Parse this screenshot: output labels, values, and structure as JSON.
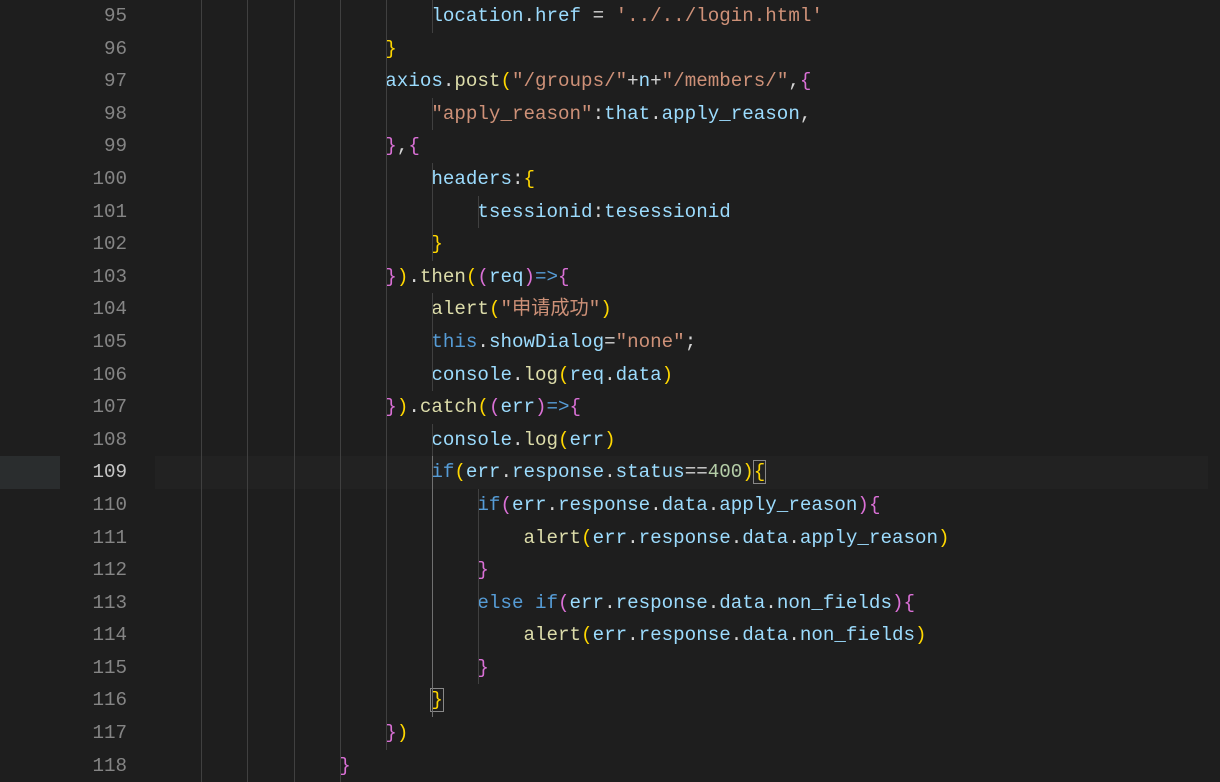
{
  "editor": {
    "activeLine": 109,
    "lines": [
      {
        "num": 95,
        "indent": 24,
        "tokens": [
          [
            "var",
            "location"
          ],
          [
            "punc",
            "."
          ],
          [
            "prop",
            "href"
          ],
          [
            "op",
            " = "
          ],
          [
            "str",
            "'../../login.html'"
          ]
        ]
      },
      {
        "num": 96,
        "indent": 20,
        "tokens": [
          [
            "ybrace",
            "}"
          ]
        ]
      },
      {
        "num": 97,
        "indent": 20,
        "tokens": [
          [
            "var",
            "axios"
          ],
          [
            "punc",
            "."
          ],
          [
            "func",
            "post"
          ],
          [
            "ybrace",
            "("
          ],
          [
            "str",
            "\"/groups/\""
          ],
          [
            "op",
            "+"
          ],
          [
            "var",
            "n"
          ],
          [
            "op",
            "+"
          ],
          [
            "str",
            "\"/members/\""
          ],
          [
            "punc",
            ","
          ],
          [
            "pbrace",
            "{"
          ]
        ]
      },
      {
        "num": 98,
        "indent": 24,
        "tokens": [
          [
            "str",
            "\"apply_reason\""
          ],
          [
            "punc",
            ":"
          ],
          [
            "var",
            "that"
          ],
          [
            "punc",
            "."
          ],
          [
            "prop",
            "apply_reason"
          ],
          [
            "punc",
            ","
          ]
        ]
      },
      {
        "num": 99,
        "indent": 20,
        "tokens": [
          [
            "pbrace",
            "}"
          ],
          [
            "punc",
            ","
          ],
          [
            "pbrace",
            "{"
          ]
        ]
      },
      {
        "num": 100,
        "indent": 24,
        "tokens": [
          [
            "prop",
            "headers"
          ],
          [
            "punc",
            ":"
          ],
          [
            "ybrace",
            "{"
          ]
        ]
      },
      {
        "num": 101,
        "indent": 28,
        "tokens": [
          [
            "prop",
            "tsessionid"
          ],
          [
            "punc",
            ":"
          ],
          [
            "var",
            "tesessionid"
          ]
        ]
      },
      {
        "num": 102,
        "indent": 24,
        "tokens": [
          [
            "ybrace",
            "}"
          ]
        ]
      },
      {
        "num": 103,
        "indent": 20,
        "tokens": [
          [
            "pbrace",
            "}"
          ],
          [
            "ybrace",
            ")"
          ],
          [
            "punc",
            "."
          ],
          [
            "func",
            "then"
          ],
          [
            "ybrace",
            "("
          ],
          [
            "pbrace",
            "("
          ],
          [
            "param",
            "req"
          ],
          [
            "pbrace",
            ")"
          ],
          [
            "kw",
            "=>"
          ],
          [
            "pbrace",
            "{"
          ]
        ]
      },
      {
        "num": 104,
        "indent": 24,
        "tokens": [
          [
            "func",
            "alert"
          ],
          [
            "ybrace",
            "("
          ],
          [
            "str",
            "\"申请成功\""
          ],
          [
            "ybrace",
            ")"
          ]
        ]
      },
      {
        "num": 105,
        "indent": 24,
        "tokens": [
          [
            "this",
            "this"
          ],
          [
            "punc",
            "."
          ],
          [
            "prop",
            "showDialog"
          ],
          [
            "op",
            "="
          ],
          [
            "str",
            "\"none\""
          ],
          [
            "punc",
            ";"
          ]
        ]
      },
      {
        "num": 106,
        "indent": 24,
        "tokens": [
          [
            "var",
            "console"
          ],
          [
            "punc",
            "."
          ],
          [
            "func",
            "log"
          ],
          [
            "ybrace",
            "("
          ],
          [
            "var",
            "req"
          ],
          [
            "punc",
            "."
          ],
          [
            "prop",
            "data"
          ],
          [
            "ybrace",
            ")"
          ]
        ]
      },
      {
        "num": 107,
        "indent": 20,
        "tokens": [
          [
            "pbrace",
            "}"
          ],
          [
            "ybrace",
            ")"
          ],
          [
            "punc",
            "."
          ],
          [
            "func",
            "catch"
          ],
          [
            "ybrace",
            "("
          ],
          [
            "pbrace",
            "("
          ],
          [
            "param",
            "err"
          ],
          [
            "pbrace",
            ")"
          ],
          [
            "kw",
            "=>"
          ],
          [
            "pbrace",
            "{"
          ]
        ]
      },
      {
        "num": 108,
        "indent": 24,
        "tokens": [
          [
            "var",
            "console"
          ],
          [
            "punc",
            "."
          ],
          [
            "func",
            "log"
          ],
          [
            "ybrace",
            "("
          ],
          [
            "var",
            "err"
          ],
          [
            "ybrace",
            ")"
          ]
        ]
      },
      {
        "num": 109,
        "indent": 24,
        "tokens": [
          [
            "kw",
            "if"
          ],
          [
            "ybrace",
            "("
          ],
          [
            "var",
            "err"
          ],
          [
            "punc",
            "."
          ],
          [
            "prop",
            "response"
          ],
          [
            "punc",
            "."
          ],
          [
            "prop",
            "status"
          ],
          [
            "op",
            "=="
          ],
          [
            "num",
            "400"
          ],
          [
            "ybrace",
            ")"
          ],
          [
            "ybracehl",
            "{"
          ]
        ],
        "active": true
      },
      {
        "num": 110,
        "indent": 28,
        "tokens": [
          [
            "kw",
            "if"
          ],
          [
            "pbrace",
            "("
          ],
          [
            "var",
            "err"
          ],
          [
            "punc",
            "."
          ],
          [
            "prop",
            "response"
          ],
          [
            "punc",
            "."
          ],
          [
            "prop",
            "data"
          ],
          [
            "punc",
            "."
          ],
          [
            "prop",
            "apply_reason"
          ],
          [
            "pbrace",
            ")"
          ],
          [
            "pbrace",
            "{"
          ]
        ]
      },
      {
        "num": 111,
        "indent": 32,
        "tokens": [
          [
            "func",
            "alert"
          ],
          [
            "ybrace",
            "("
          ],
          [
            "var",
            "err"
          ],
          [
            "punc",
            "."
          ],
          [
            "prop",
            "response"
          ],
          [
            "punc",
            "."
          ],
          [
            "prop",
            "data"
          ],
          [
            "punc",
            "."
          ],
          [
            "prop",
            "apply_reason"
          ],
          [
            "ybrace",
            ")"
          ]
        ]
      },
      {
        "num": 112,
        "indent": 28,
        "tokens": [
          [
            "pbrace",
            "}"
          ]
        ]
      },
      {
        "num": 113,
        "indent": 28,
        "tokens": [
          [
            "kw",
            "else"
          ],
          [
            "default",
            " "
          ],
          [
            "kw",
            "if"
          ],
          [
            "pbrace",
            "("
          ],
          [
            "var",
            "err"
          ],
          [
            "punc",
            "."
          ],
          [
            "prop",
            "response"
          ],
          [
            "punc",
            "."
          ],
          [
            "prop",
            "data"
          ],
          [
            "punc",
            "."
          ],
          [
            "prop",
            "non_fields"
          ],
          [
            "pbrace",
            ")"
          ],
          [
            "pbrace",
            "{"
          ]
        ]
      },
      {
        "num": 114,
        "indent": 32,
        "tokens": [
          [
            "func",
            "alert"
          ],
          [
            "ybrace",
            "("
          ],
          [
            "var",
            "err"
          ],
          [
            "punc",
            "."
          ],
          [
            "prop",
            "response"
          ],
          [
            "punc",
            "."
          ],
          [
            "prop",
            "data"
          ],
          [
            "punc",
            "."
          ],
          [
            "prop",
            "non_fields"
          ],
          [
            "ybrace",
            ")"
          ]
        ]
      },
      {
        "num": 115,
        "indent": 28,
        "tokens": [
          [
            "pbrace",
            "}"
          ]
        ]
      },
      {
        "num": 116,
        "indent": 24,
        "tokens": [
          [
            "ybracehl",
            "}"
          ]
        ]
      },
      {
        "num": 117,
        "indent": 20,
        "tokens": [
          [
            "pbrace",
            "}"
          ],
          [
            "ybrace",
            ")"
          ]
        ]
      },
      {
        "num": 118,
        "indent": 16,
        "tokens": [
          [
            "pbrace",
            "}"
          ]
        ]
      }
    ],
    "indentGuides": {
      "levels": [
        4,
        8,
        12,
        16,
        20,
        24,
        28
      ],
      "highlightLevel": 24,
      "highlightRange": [
        109,
        116
      ]
    }
  }
}
